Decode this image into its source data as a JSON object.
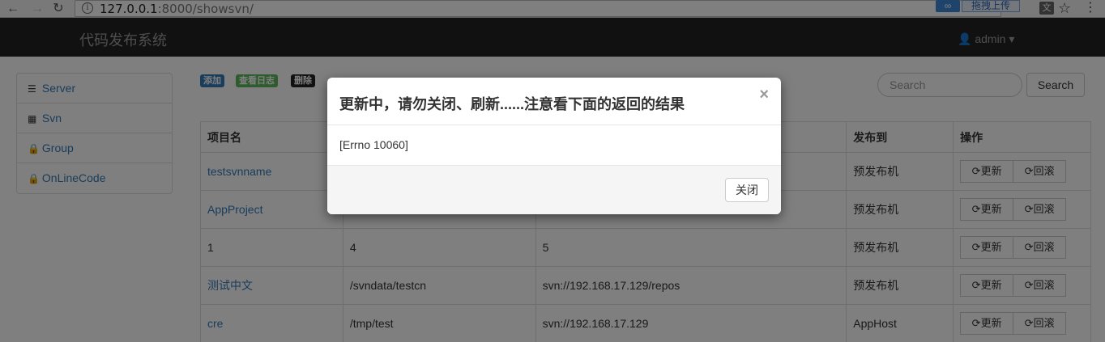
{
  "browser": {
    "back": "←",
    "forward": "→",
    "reload": "↻",
    "url_host": "127.0.0.1",
    "url_rest": ":8000/showsvn/",
    "ext_cloud_icon": "∞",
    "ext_upload_label": "拖拽上传",
    "star": "☆",
    "menu": "⋮"
  },
  "navbar": {
    "brand": "代码发布系统",
    "user": "admin ▾"
  },
  "sidebar": {
    "items": [
      {
        "icon": "list-icon",
        "glyph": "☰",
        "label": "Server"
      },
      {
        "icon": "grid-icon",
        "glyph": "▦",
        "label": "Svn"
      },
      {
        "icon": "lock-icon",
        "glyph": "🔒",
        "label": "Group"
      },
      {
        "icon": "lock-icon",
        "glyph": "🔒",
        "label": "OnLineCode"
      }
    ]
  },
  "toolbar": {
    "add": "添加",
    "log": "查看日志",
    "delete": "删除",
    "search_placeholder": "Search",
    "search_button": "Search"
  },
  "table": {
    "headers": [
      "项目名",
      "",
      "",
      "发布到",
      "操作"
    ],
    "update_label": "⟳更新",
    "rollback_label": "⟳回滚",
    "rows": [
      {
        "name": "testsvnname",
        "path": "",
        "repo": "",
        "target": "预发布机"
      },
      {
        "name": "AppProject",
        "path": "",
        "repo": "",
        "target": "预发布机"
      },
      {
        "name": "1",
        "path": "4",
        "repo": "5",
        "target": "预发布机"
      },
      {
        "name": "测试中文",
        "path": "/svndata/testcn",
        "repo": "svn://192.168.17.129/repos",
        "target": "预发布机"
      },
      {
        "name": "cre",
        "path": "/tmp/test",
        "repo": "svn://192.168.17.129",
        "target": "AppHost"
      }
    ]
  },
  "modal": {
    "title": "更新中，请勿关闭、刷新......注意看下面的返回的结果",
    "close_x": "×",
    "body": "[Errno 10060]",
    "footer_button": "关闭"
  }
}
